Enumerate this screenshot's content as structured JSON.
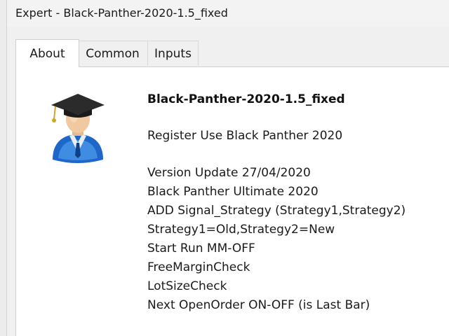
{
  "window": {
    "title": "Expert - Black-Panther-2020-1.5_fixed"
  },
  "tabs": [
    {
      "label": "About",
      "active": true
    },
    {
      "label": "Common",
      "active": false
    },
    {
      "label": "Inputs",
      "active": false
    }
  ],
  "about": {
    "icon": "graduate-user-icon",
    "name": "Black-Panther-2020-1.5_fixed",
    "register": "Register Use Black Panther 2020",
    "description": [
      "Version Update 27/04/2020",
      "Black Panther Ultimate 2020",
      "ADD Signal_Strategy (Strategy1,Strategy2)",
      "Strategy1=Old,Strategy2=New",
      "Start Run MM-OFF",
      "FreeMarginCheck",
      "LotSizeCheck",
      "Next OpenOrder ON-OFF (is Last Bar)"
    ]
  },
  "colors": {
    "window_bg": "#f0f0f0",
    "panel_bg": "#ffffff",
    "icon_blue": "#1e66c8"
  }
}
